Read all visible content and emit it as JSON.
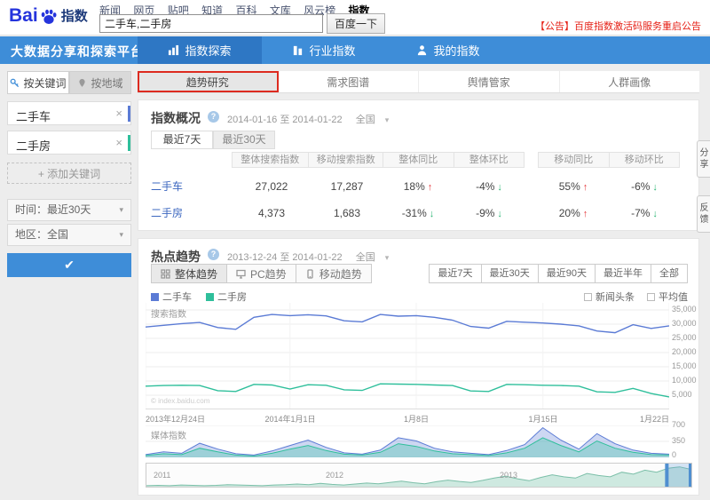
{
  "ui": {
    "close_glyph": "×",
    "caret_glyph": "▾",
    "help_glyph": "?",
    "check_glyph": "✔"
  },
  "colors": {
    "navbar": "#3e8dd8",
    "navbar_active": "#2e77c4",
    "series_car": "#5b7bd5",
    "series_house": "#2fbf9b",
    "up_red": "#e4393c",
    "down_green": "#2ab573",
    "announcement_red": "#e62117",
    "highlight_red": "#dd2b20"
  },
  "header": {
    "logo_bai": "Bai",
    "logo_suffix": "指数",
    "nav_links": [
      "新闻",
      "网页",
      "贴吧",
      "知道",
      "百科",
      "文库",
      "风云榜",
      "指数"
    ],
    "search_value": "二手车,二手房",
    "search_button": "百度一下",
    "announcement": "【公告】百度指数激活码服务重启公告"
  },
  "navbar": {
    "slogan": "大数据分享和探索平台",
    "tabs": [
      {
        "label": "指数探索",
        "active": true
      },
      {
        "label": "行业指数",
        "active": false
      },
      {
        "label": "我的指数",
        "active": false
      }
    ]
  },
  "sidebar": {
    "tabs": [
      {
        "label": "按关键词",
        "active": true
      },
      {
        "label": "按地域",
        "active": false
      }
    ],
    "keywords": [
      {
        "label": "二手车",
        "color": "#5b7bd5"
      },
      {
        "label": "二手房",
        "color": "#2fbf9b"
      }
    ],
    "add_button": "+ 添加关键词",
    "time_filter": "时间：最近30天",
    "region_filter": "地区：全国"
  },
  "main_tabs": [
    {
      "label": "趋势研究",
      "active": true,
      "highlighted": true
    },
    {
      "label": "需求图谱",
      "active": false
    },
    {
      "label": "舆情管家",
      "active": false
    },
    {
      "label": "人群画像",
      "active": false
    }
  ],
  "overview": {
    "title": "指数概况",
    "date_range": "2014-01-16 至 2014-01-22",
    "region": "全国",
    "tabs": [
      {
        "label": "最近7天",
        "active": true
      },
      {
        "label": "最近30天",
        "active": false
      }
    ],
    "col_groups": [
      [
        "整体搜索指数",
        "移动搜索指数"
      ],
      [
        "整体同比",
        "整体环比"
      ],
      [
        "移动同比",
        "移动环比"
      ]
    ],
    "rows": [
      {
        "name": "二手车",
        "values": [
          "27,022",
          "17,287"
        ],
        "changes": [
          {
            "text": "18%",
            "dir": "up"
          },
          {
            "text": "-4%",
            "dir": "down"
          },
          {
            "text": "55%",
            "dir": "up"
          },
          {
            "text": "-6%",
            "dir": "down"
          }
        ]
      },
      {
        "name": "二手房",
        "values": [
          "4,373",
          "1,683"
        ],
        "changes": [
          {
            "text": "-31%",
            "dir": "down"
          },
          {
            "text": "-9%",
            "dir": "down"
          },
          {
            "text": "20%",
            "dir": "up"
          },
          {
            "text": "-7%",
            "dir": "down"
          }
        ]
      }
    ]
  },
  "trend": {
    "title": "热点趋势",
    "date_range": "2013-12-24 至 2014-01-22",
    "region": "全国",
    "tabs": [
      {
        "label": "整体趋势",
        "active": true
      },
      {
        "label": "PC趋势",
        "active": false
      },
      {
        "label": "移动趋势",
        "active": false
      }
    ],
    "range_buttons": [
      "最近7天",
      "最近30天",
      "最近90天",
      "最近半年",
      "全部"
    ],
    "legend": [
      {
        "label": "二手车",
        "color": "#5b7bd5"
      },
      {
        "label": "二手房",
        "color": "#2fbf9b"
      }
    ],
    "checkboxes": [
      "新闻头条",
      "平均值"
    ]
  },
  "side_tools": [
    "分享",
    "反馈"
  ],
  "chart_data": [
    {
      "type": "line",
      "name": "search-index-trend",
      "title": "搜索指数",
      "watermark": "© index.baidu.com",
      "x_start": "2013-12-24",
      "x_end": "2014-01-22",
      "xticks": [
        "2013年12月24日",
        "2014年1月1日",
        "1月8日",
        "1月15日",
        "1月22日"
      ],
      "xtick_pos": [
        0,
        0.276,
        0.517,
        0.759,
        1
      ],
      "yticks": [
        35000,
        30000,
        25000,
        20000,
        15000,
        10000,
        5000
      ],
      "ytick_labels": [
        "35,000",
        "30,000",
        "25,000",
        "20,000",
        "15,000",
        "10,000",
        "5,000"
      ],
      "ylim": [
        0,
        37500
      ],
      "series": [
        {
          "name": "二手车",
          "color": "#5b7bd5",
          "values": [
            29000,
            29600,
            30200,
            30600,
            28800,
            28200,
            32400,
            33400,
            33000,
            33300,
            32900,
            31200,
            30800,
            33400,
            32800,
            33000,
            32400,
            31400,
            29200,
            28600,
            31000,
            30700,
            30400,
            30000,
            29400,
            27600,
            27000,
            29800,
            28500,
            29400
          ]
        },
        {
          "name": "二手房",
          "color": "#2fbf9b",
          "values": [
            8200,
            8400,
            8500,
            8400,
            6600,
            6300,
            8800,
            8600,
            7200,
            8700,
            8500,
            6900,
            6700,
            9000,
            8900,
            8800,
            8600,
            8400,
            6500,
            6300,
            8800,
            8700,
            8500,
            8400,
            8200,
            6200,
            6000,
            7400,
            5600,
            4400
          ]
        }
      ]
    },
    {
      "type": "area",
      "name": "media-index-trend",
      "title": "媒体指数",
      "yticks": [
        700,
        350,
        0
      ],
      "ytick_labels": [
        "700",
        "350",
        "0"
      ],
      "ylim": [
        0,
        700
      ],
      "series": [
        {
          "name": "二手车",
          "color": "#5b7bd5",
          "values": [
            60,
            120,
            90,
            310,
            180,
            80,
            50,
            140,
            260,
            380,
            220,
            100,
            70,
            160,
            430,
            360,
            200,
            120,
            90,
            60,
            150,
            280,
            650,
            380,
            180,
            520,
            300,
            160,
            90,
            70
          ]
        },
        {
          "name": "二手房",
          "color": "#2fbf9b",
          "values": [
            40,
            80,
            60,
            200,
            120,
            50,
            30,
            90,
            180,
            260,
            150,
            70,
            50,
            110,
            300,
            240,
            140,
            80,
            60,
            40,
            100,
            200,
            430,
            260,
            120,
            360,
            200,
            110,
            60,
            50
          ]
        }
      ]
    },
    {
      "type": "timeline",
      "name": "history-range-slider",
      "years": [
        "2011",
        "2012",
        "2013"
      ],
      "ylim": [
        0,
        70
      ],
      "fill": "#a8d8c8",
      "stroke": "#7bbfa8",
      "selection": [
        0.955,
        1
      ],
      "values": [
        3,
        4,
        3,
        5,
        4,
        3,
        4,
        6,
        5,
        4,
        3,
        5,
        6,
        8,
        6,
        10,
        7,
        5,
        8,
        11,
        9,
        13,
        17,
        12,
        9,
        15,
        20,
        16,
        13,
        19,
        26,
        32,
        24,
        18,
        28,
        36,
        30,
        26,
        40,
        34,
        30,
        44,
        38,
        50,
        44,
        56,
        60,
        52
      ]
    }
  ]
}
